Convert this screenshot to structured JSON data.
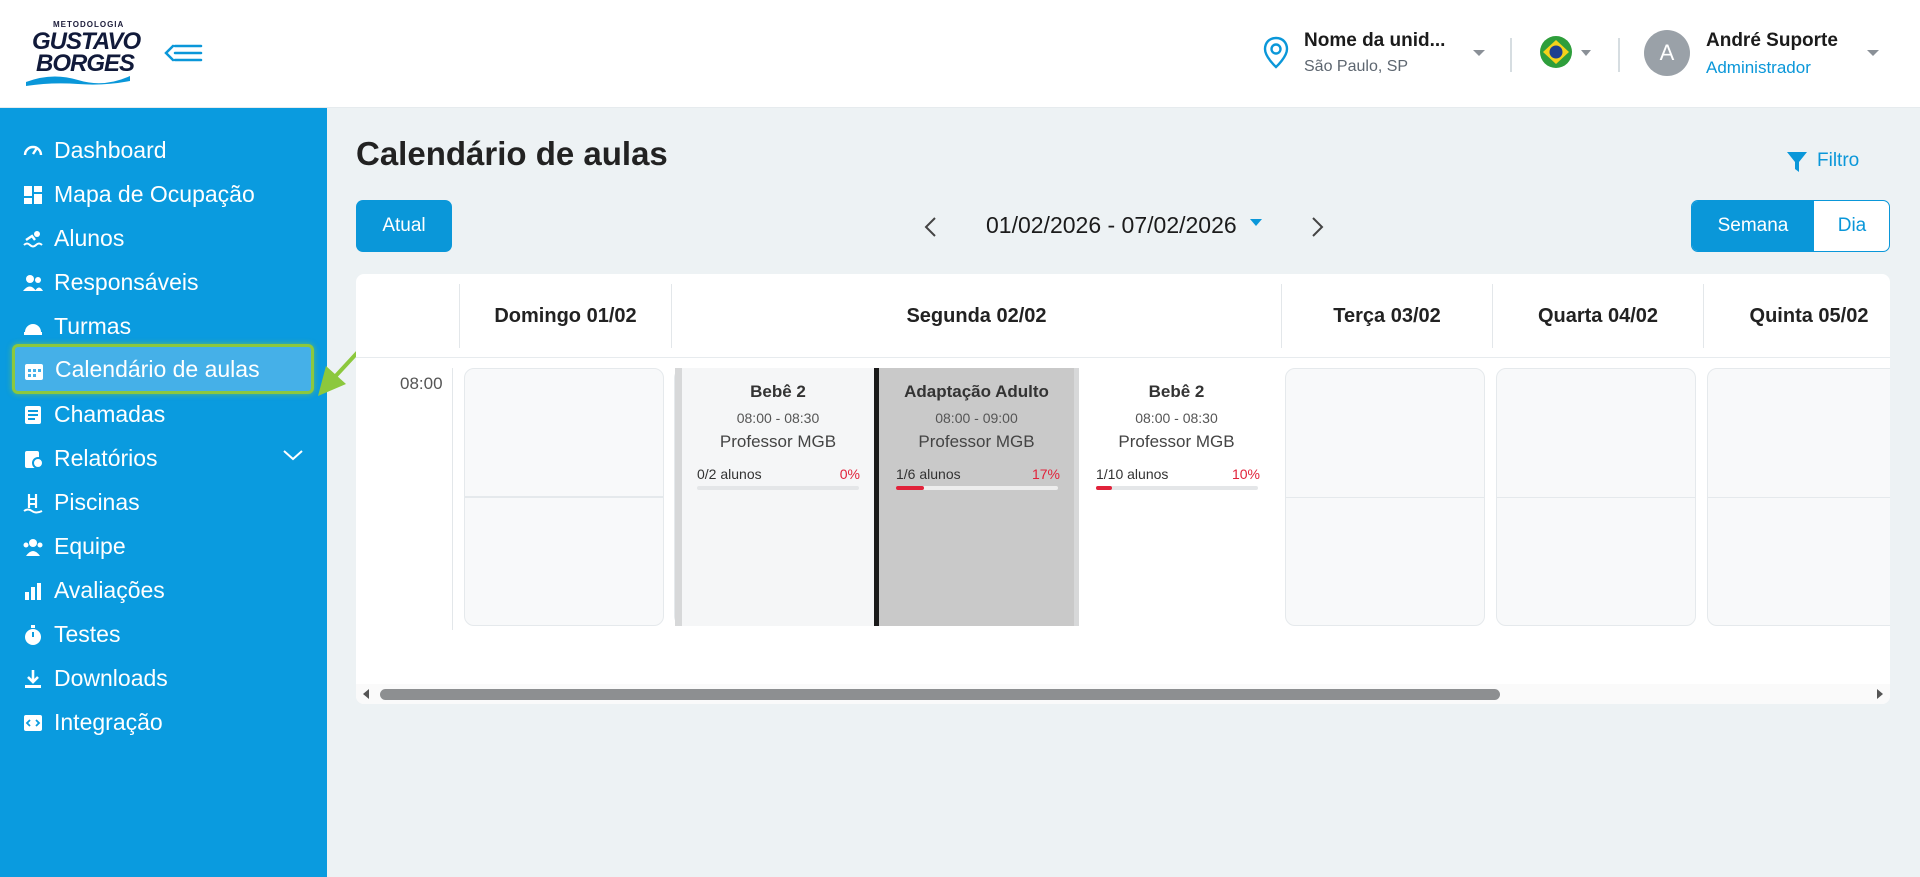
{
  "header": {
    "logo_top": "METODOLOGIA",
    "logo_line1": "GUSTAVO",
    "logo_line2": "BORGES",
    "unit_name": "Nome da unid...",
    "unit_city": "São Paulo, SP",
    "user_initial": "A",
    "user_name": "André Suporte",
    "user_role": "Administrador"
  },
  "sidebar": {
    "items": [
      {
        "label": "Dashboard",
        "icon": "dashboard-icon"
      },
      {
        "label": "Mapa de Ocupação",
        "icon": "grid-icon"
      },
      {
        "label": "Alunos",
        "icon": "swimmer-icon"
      },
      {
        "label": "Responsáveis",
        "icon": "users-icon"
      },
      {
        "label": "Turmas",
        "icon": "helmet-icon"
      },
      {
        "label": "Calendário de aulas",
        "icon": "calendar-icon"
      },
      {
        "label": "Chamadas",
        "icon": "list-icon"
      },
      {
        "label": "Relatórios",
        "icon": "report-icon"
      },
      {
        "label": "Piscinas",
        "icon": "pool-ladder-icon"
      },
      {
        "label": "Equipe",
        "icon": "team-icon"
      },
      {
        "label": "Avaliações",
        "icon": "chart-icon"
      },
      {
        "label": "Testes",
        "icon": "stopwatch-icon"
      },
      {
        "label": "Downloads",
        "icon": "download-icon"
      },
      {
        "label": "Integração",
        "icon": "code-icon"
      }
    ],
    "active_index": 5
  },
  "main": {
    "title": "Calendário de aulas",
    "filter_label": "Filtro",
    "current_button": "Atual",
    "date_range": "01/02/2026 - 07/02/2026",
    "view_week": "Semana",
    "view_day": "Dia"
  },
  "calendar": {
    "days": [
      "Domingo 01/02",
      "Segunda 02/02",
      "Terça 03/02",
      "Quarta 04/02",
      "Quinta 05/02"
    ],
    "time_slot": "08:00",
    "events": [
      {
        "title": "Bebê 2",
        "time": "08:00 - 08:30",
        "teacher": "Professor MGB",
        "count": "0/2 alunos",
        "pct": "0%",
        "fill": 0
      },
      {
        "title": "Adaptação Adulto",
        "time": "08:00 - 09:00",
        "teacher": "Professor MGB",
        "count": "1/6 alunos",
        "pct": "17%",
        "fill": 0.17
      },
      {
        "title": "Bebê 2",
        "time": "08:00 - 08:30",
        "teacher": "Professor MGB",
        "count": "1/10 alunos",
        "pct": "10%",
        "fill": 0.1
      }
    ]
  },
  "colors": {
    "primary": "#0a97d9",
    "sidebar": "#0a9bdf",
    "highlight_border": "#8cc83d",
    "occupancy": "#e1223a"
  }
}
